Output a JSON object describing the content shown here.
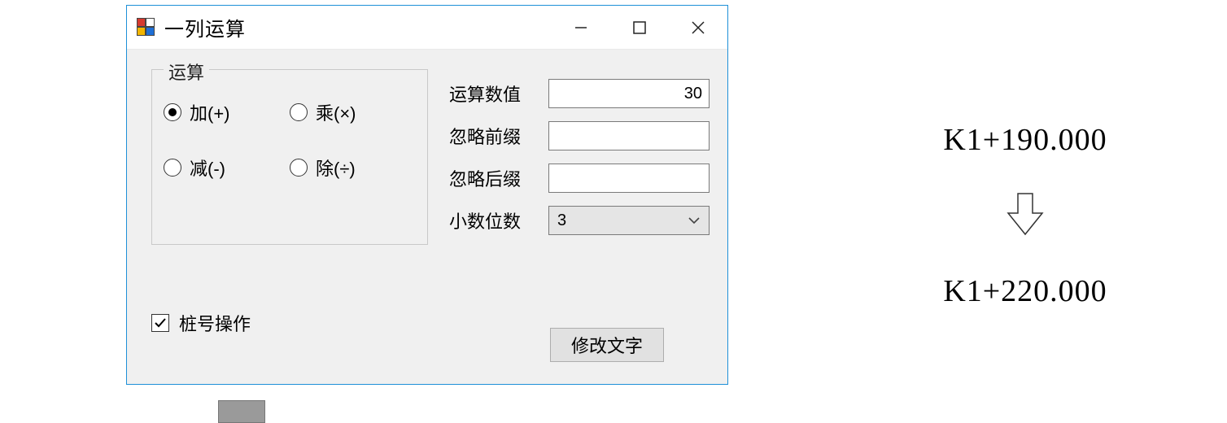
{
  "dialog": {
    "title": "一列运算",
    "group": {
      "title": "运算",
      "options": {
        "add": "加(+)",
        "mul": "乘(×)",
        "sub": "减(-)",
        "div": "除(÷)"
      },
      "selected": "add"
    },
    "fields": {
      "value_label": "运算数值",
      "value": "30",
      "ignore_prefix_label": "忽略前缀",
      "ignore_prefix": "",
      "ignore_suffix_label": "忽略后缀",
      "ignore_suffix": "",
      "decimal_label": "小数位数",
      "decimal": "3"
    },
    "checkbox": {
      "label": "桩号操作",
      "checked": true
    },
    "submit": "修改文字"
  },
  "example": {
    "before": "K1+190.000",
    "after": "K1+220.000"
  }
}
